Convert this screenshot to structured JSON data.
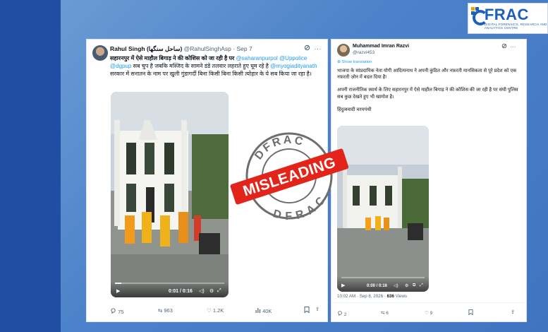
{
  "logo": {
    "text": "FRAC",
    "tagline": "DIGITAL FORENSICS, RESEARCH AND ANALYTICS CENTRE"
  },
  "tweet1": {
    "display_name": "Rahul Singh (ساحل سنگھا)",
    "handle": "@RahulSinghAsp",
    "sep": "·",
    "date": "Sep 7",
    "text_a": "सहारनपुर में ऐसे माहौल बिगाड़ ने की कोशिस को जा रही है पर ",
    "mention1": "@saharanpurpol",
    "mention2": "@Uppolice",
    "mention3": "@dgpup",
    "text_b": " सब चुप है जबकि मस्जिद के सामने डंडे तलवार लहराते हुए घूम रहे है ",
    "mention4": "@myogiadityanath",
    "text_c": " सरकार में सनातन के नाम पर खुली गुंडागर्दी बिना किसी बिना किसी त्योहार के ये सब किया जा रहा है।",
    "video_time": "0:01 / 0:16",
    "video_progress": 0.06,
    "replies": "75",
    "reposts": "963",
    "likes": "1.2K",
    "views": "40K"
  },
  "tweet2": {
    "display_name": "Muhammad Imran Razvi",
    "handle": "@razvi453",
    "show_translation": "Show translation",
    "para1": "भाजपा के सांप्रदायिक नेता योगी आदित्यनाथ ने अपनी कुंठित और नफ़रती मानसिकता से पूरे प्रदेश को एक नफ़रती ज़ोन में बदल दिया है!",
    "para2": "अपनी राजनीतिक स्वार्थ के लिए सहारनपुर में ऐसे माहौल बिगाड़ ने की कोशिस की जा रही है पर संघी पुलिस सब कुछ देखते हुए भी खामोश है।",
    "para3": "हिंदुत्ववादी चरमपंथी",
    "video_time": "0:00 / 0:16",
    "video_progress": 0.0,
    "time": "10:02 AM",
    "date": "Sep 8, 2026",
    "views_count": "636",
    "views_label": "Views",
    "replies": "2",
    "reposts": "6",
    "likes": "9"
  },
  "stamp": {
    "top": "DFRAC",
    "center": "MISLEADING",
    "bottom": "DFRAC"
  },
  "colors": {
    "background": "#4c82c9",
    "left_bar": "#1f4ea3",
    "link": "#1d9bf0",
    "stamp_red": "#e3241b",
    "stamp_gray": "#6d6d6d"
  }
}
